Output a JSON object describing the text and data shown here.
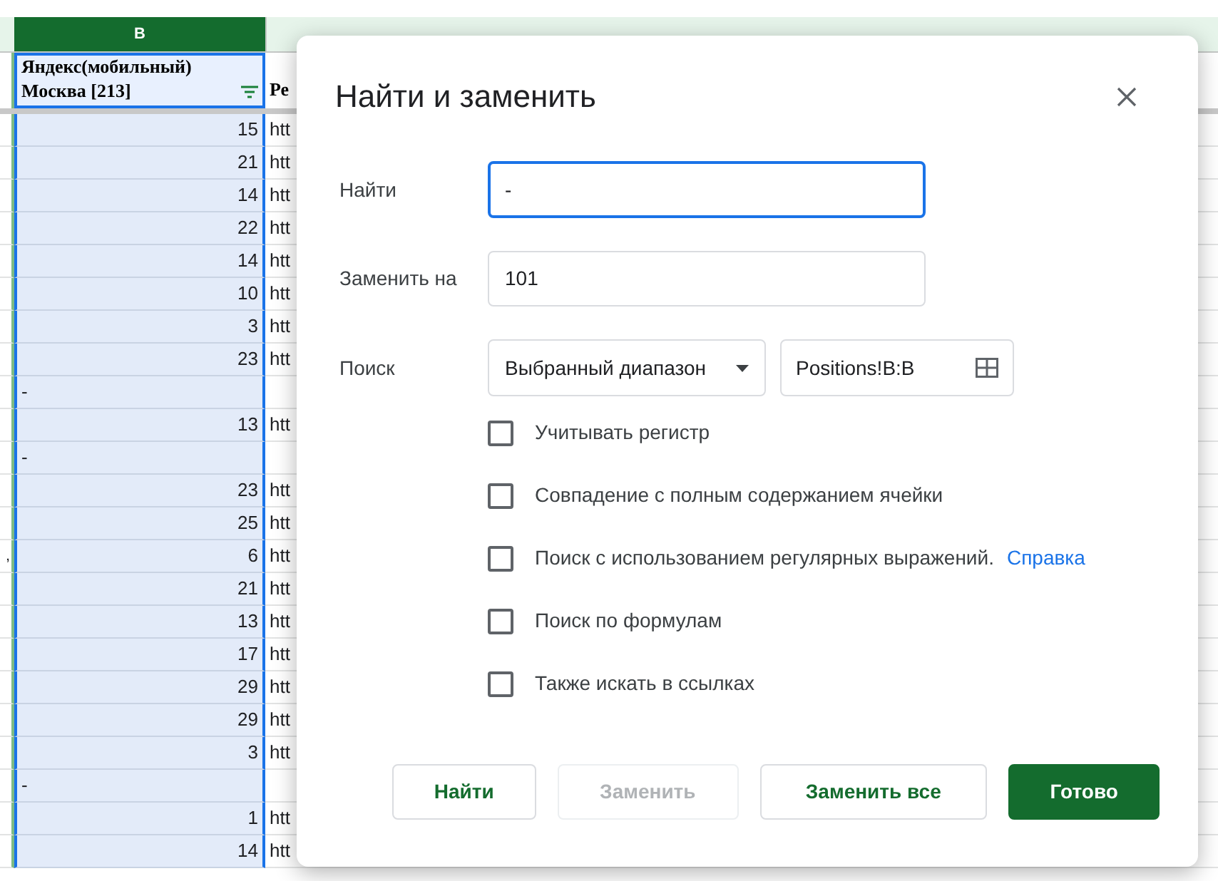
{
  "sheet": {
    "column_header": {
      "label": "B",
      "selected": true
    },
    "header_row": {
      "column_b": "Яндекс(мобильный)\nМосква [213]",
      "column_c": "Ре"
    },
    "rows": [
      {
        "kind": "number",
        "column_b": "15",
        "column_c": "htt"
      },
      {
        "kind": "number",
        "column_b": "21",
        "column_c": "htt"
      },
      {
        "kind": "number",
        "column_b": "14",
        "column_c": "htt"
      },
      {
        "kind": "number",
        "column_b": "22",
        "column_c": "htt"
      },
      {
        "kind": "number",
        "column_b": "14",
        "column_c": "htt"
      },
      {
        "kind": "number",
        "column_b": "10",
        "column_c": "htt"
      },
      {
        "kind": "number",
        "column_b": "3",
        "column_c": "htt"
      },
      {
        "kind": "number",
        "column_b": "23",
        "column_c": "htt"
      },
      {
        "kind": "text",
        "column_b": "-"
      },
      {
        "kind": "number",
        "column_b": "13",
        "column_c": "htt"
      },
      {
        "kind": "text",
        "column_b": "-"
      },
      {
        "kind": "number",
        "column_b": "23",
        "column_c": "htt"
      },
      {
        "kind": "number",
        "column_b": "25",
        "column_c": "htt"
      },
      {
        "kind": "number",
        "column_a": ",",
        "column_b": "6",
        "column_c": "htt"
      },
      {
        "kind": "number",
        "column_b": "21",
        "column_c": "htt"
      },
      {
        "kind": "number",
        "column_b": "13",
        "column_c": "htt"
      },
      {
        "kind": "number",
        "column_b": "17",
        "column_c": "htt"
      },
      {
        "kind": "number",
        "column_b": "29",
        "column_c": "htt"
      },
      {
        "kind": "number",
        "column_b": "29",
        "column_c": "htt"
      },
      {
        "kind": "number",
        "column_b": "3",
        "column_c": "htt"
      },
      {
        "kind": "text",
        "column_b": "-"
      },
      {
        "kind": "number",
        "column_b": "1",
        "column_c": "htt"
      },
      {
        "kind": "number",
        "column_b": "14",
        "column_c": "htt"
      }
    ]
  },
  "dialog": {
    "title": "Найти и заменить",
    "find": {
      "label": "Найти",
      "value": "-",
      "focused": true
    },
    "replace": {
      "label": "Заменить на",
      "value": "101",
      "focused": false
    },
    "search": {
      "label": "Поиск",
      "scope": "Выбранный диапазон",
      "range": "Positions!B:B"
    },
    "options": [
      {
        "label": "Учитывать регистр",
        "checked": false
      },
      {
        "label": "Совпадение с полным содержанием ячейки",
        "checked": false
      },
      {
        "label": "Поиск с использованием регулярных выражений.",
        "link": "Справка",
        "checked": false
      },
      {
        "label": "Поиск по формулам",
        "checked": false
      },
      {
        "label": "Также искать в ссылках",
        "checked": false
      }
    ],
    "buttons": [
      {
        "label": "Найти",
        "kind": "outlined",
        "disabled": false
      },
      {
        "label": "Заменить",
        "kind": "outlined",
        "disabled": true
      },
      {
        "label": "Заменить все",
        "kind": "outlined",
        "disabled": false
      },
      {
        "label": "Готово",
        "kind": "primary",
        "disabled": false
      }
    ]
  }
}
